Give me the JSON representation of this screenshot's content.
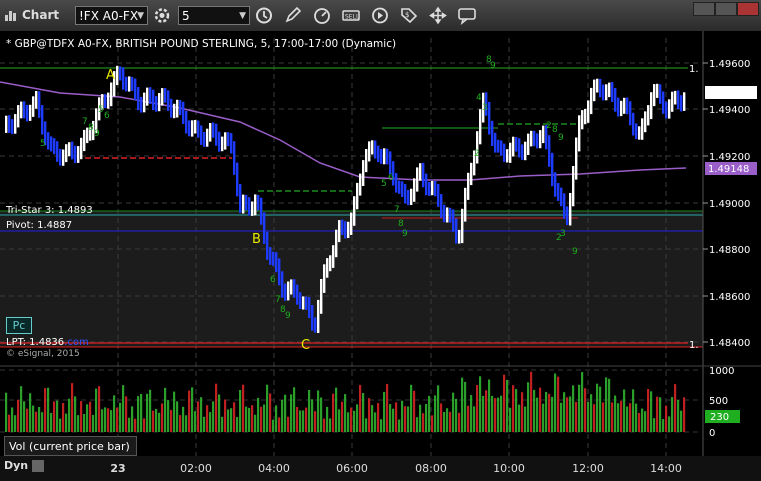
{
  "window": {
    "title": "Chart",
    "symbol_field": "!FX A0-FX",
    "interval_field": "5"
  },
  "toolbar": {
    "icons": [
      "refresh-icon",
      "time-icon",
      "pencil-icon",
      "gauge-icon",
      "sell-icon",
      "play-icon",
      "tag-icon",
      "move-icon",
      "message-icon"
    ]
  },
  "chart": {
    "header": "* GBP@TDFX A0-FX, BRITISH POUND STERLING, 5, 17:00-17:00 (Dynamic)",
    "overlays": {
      "tri_star": "Tri-Star 3: 1.4893",
      "pivot": "Pivot: 1.4887",
      "lpt": "LPT: 1.4836",
      "lpt_tail": ".com",
      "copyright": "© eSignal, 2015",
      "pc_button": "Pc"
    },
    "price_axis": [
      "1.49600",
      "1.49400",
      "1.49200",
      "1.49000",
      "1.48800",
      "1.48600",
      "1.48400"
    ],
    "price_badges": {
      "last": "1.49472",
      "ma": "1.49148"
    },
    "line_labels": {
      "upper": "1.",
      "lower": "1."
    },
    "point_labels": [
      "A",
      "B",
      "C"
    ],
    "sequence_numbers": [
      "8",
      "9",
      "5",
      "6",
      "7",
      "8",
      "9",
      "5",
      "6",
      "7",
      "8",
      "9",
      "2",
      "3",
      "4",
      "5",
      "6",
      "7",
      "8",
      "9",
      "3",
      "2",
      "9",
      "2",
      "8",
      "9"
    ],
    "colors": {
      "up_bar": "#ffffff",
      "down_bar": "#1e3cff",
      "moving_average": "#9a5ec8",
      "green_level": "#1c8a1c",
      "red_level": "#e02020",
      "pivot_line": "#2020c0",
      "seq_text": "#1fae1f"
    }
  },
  "volume": {
    "legend": "Vol (current price bar)",
    "axis": [
      "1000",
      "500",
      "0"
    ],
    "current": "230"
  },
  "time_axis": {
    "mode": "Dyn",
    "labels": [
      "23",
      "02:00",
      "04:00",
      "06:00",
      "08:00",
      "10:00",
      "12:00",
      "14:00"
    ]
  }
}
